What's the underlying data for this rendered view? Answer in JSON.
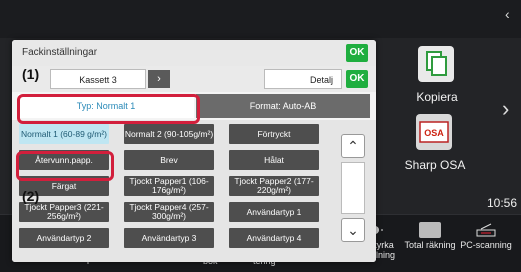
{
  "home": {
    "apps": [
      {
        "label": "Kopiera",
        "icon": "copy-icon"
      },
      {
        "label": "Sharp OSA",
        "icon": "sharp-osa-icon",
        "icon_text": "OSA"
      }
    ],
    "clock": "10:56",
    "dock": [
      {
        "label": "Y",
        "icon": "toner-icon"
      },
      {
        "label": "bok",
        "icon": "book-icon"
      },
      {
        "label": "tering",
        "icon": "sorting-icon"
      },
      {
        "label": "ljusstyrka inställning",
        "icon": "brightness-icon"
      },
      {
        "label": "Total räkning",
        "icon": "counter-icon"
      },
      {
        "label": "PC-scanning",
        "icon": "pc-scan-icon"
      }
    ]
  },
  "dialog": {
    "title": "Fackinställningar",
    "ok_label": "OK",
    "tray_value": "Kassett 3",
    "detail_label": "Detalj",
    "tabs": {
      "type_label": "Typ: Normalt 1",
      "format_label": "Format: Auto-AB"
    },
    "options": [
      [
        "Normalt 1 (60-89 g/m²)",
        "Normalt 2 (90-105g/m²)",
        "Förtryckt"
      ],
      [
        "Återvunn.papp.",
        "Brev",
        "Hålat"
      ],
      [
        "Färgat",
        "Tjockt Papper1 (106-176g/m²)",
        "Tjockt Papper2 (177-220g/m²)"
      ],
      [
        "Tjockt Papper3 (221-256g/m²)",
        "Tjockt Papper4 (257-300g/m²)",
        "Användartyp 1"
      ],
      [
        "Användartyp 2",
        "Användartyp 3",
        "Användartyp 4"
      ]
    ]
  },
  "callouts": {
    "one": "(1)",
    "two": "(2)"
  },
  "colors": {
    "ok_green": "#1fae3f",
    "highlight_red": "#d21f3c",
    "selected_blue": "#bfe6f2"
  }
}
